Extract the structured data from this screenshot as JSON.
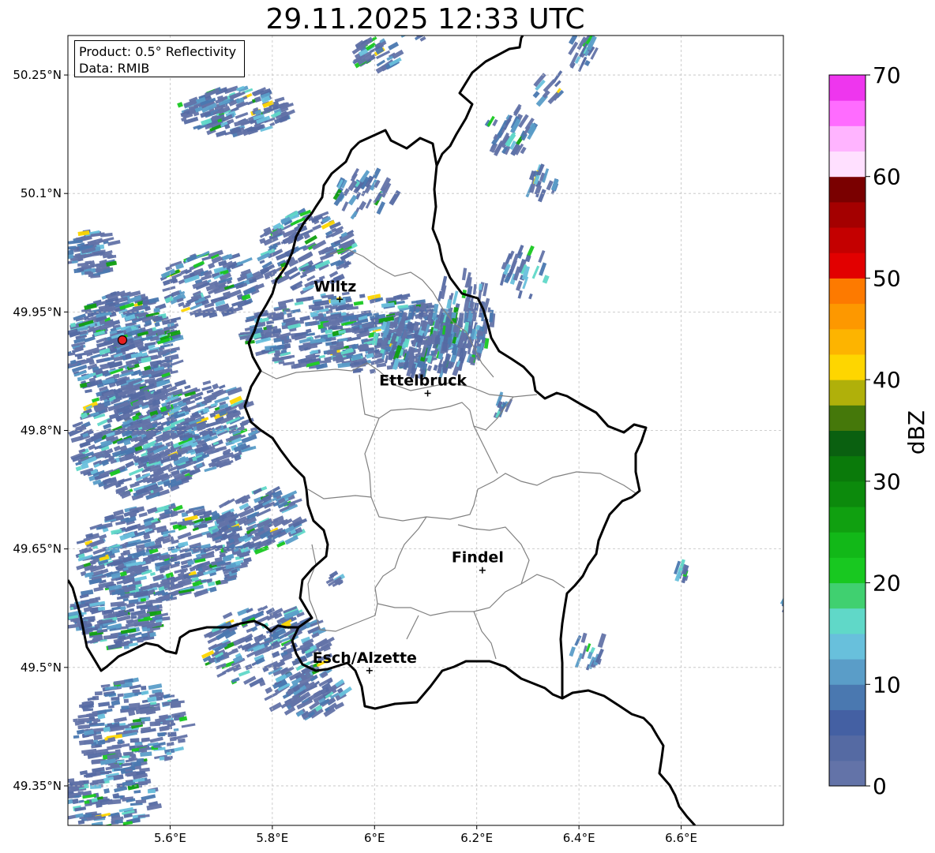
{
  "title": "29.11.2025 12:33 UTC",
  "info": {
    "product": "Product: 0.5° Reflectivity",
    "data": "Data: RMIB"
  },
  "axes": {
    "lon_range": [
      5.4,
      6.8
    ],
    "lat_range": [
      49.3,
      50.3
    ],
    "lon_ticks": [
      {
        "value": 5.6,
        "label": "5.6°E"
      },
      {
        "value": 5.8,
        "label": "5.8°E"
      },
      {
        "value": 6.0,
        "label": "6°E"
      },
      {
        "value": 6.2,
        "label": "6.2°E"
      },
      {
        "value": 6.4,
        "label": "6.4°E"
      },
      {
        "value": 6.6,
        "label": "6.6°E"
      }
    ],
    "lat_ticks": [
      {
        "value": 49.35,
        "label": "49.35°N"
      },
      {
        "value": 49.5,
        "label": "49.5°N"
      },
      {
        "value": 49.65,
        "label": "49.65°N"
      },
      {
        "value": 49.8,
        "label": "49.8°N"
      },
      {
        "value": 49.95,
        "label": "49.95°N"
      },
      {
        "value": 50.1,
        "label": "50.1°N"
      },
      {
        "value": 50.25,
        "label": "50.25°N"
      }
    ],
    "grid": true
  },
  "cities": [
    {
      "name": "Wiltz",
      "lon": 5.932,
      "lat": 49.966
    },
    {
      "name": "Ettelbruck",
      "lon": 6.104,
      "lat": 49.847
    },
    {
      "name": "Findel",
      "lon": 6.211,
      "lat": 49.623
    },
    {
      "name": "Esch/Alzette",
      "lon": 5.99,
      "lat": 49.496
    }
  ],
  "radar_site": {
    "lon": 5.505,
    "lat": 49.914
  },
  "colorbar": {
    "label": "dBZ",
    "min": 0,
    "max": 70,
    "ticks": [
      "0",
      "10",
      "20",
      "30",
      "40",
      "50",
      "60",
      "70"
    ],
    "colors": [
      "#6373a8",
      "#556aa3",
      "#4460a3",
      "#4a78b0",
      "#5a9dc8",
      "#68c0dc",
      "#60d8c8",
      "#40d070",
      "#18c820",
      "#12b818",
      "#10a010",
      "#0c8a0c",
      "#0a7a0a",
      "#0a6010",
      "#45780a",
      "#b0b00a",
      "#fed600",
      "#fdb400",
      "#fd9800",
      "#fd7a00",
      "#e20000",
      "#c40000",
      "#a40000",
      "#7a0000",
      "#ffe0ff",
      "#ffb4ff",
      "#ff6cff",
      "#ee36ee"
    ]
  },
  "colors": {
    "border": "#000000",
    "canton": "#808080",
    "grid": "#c0c0c0",
    "radar_site": "#e82020"
  }
}
